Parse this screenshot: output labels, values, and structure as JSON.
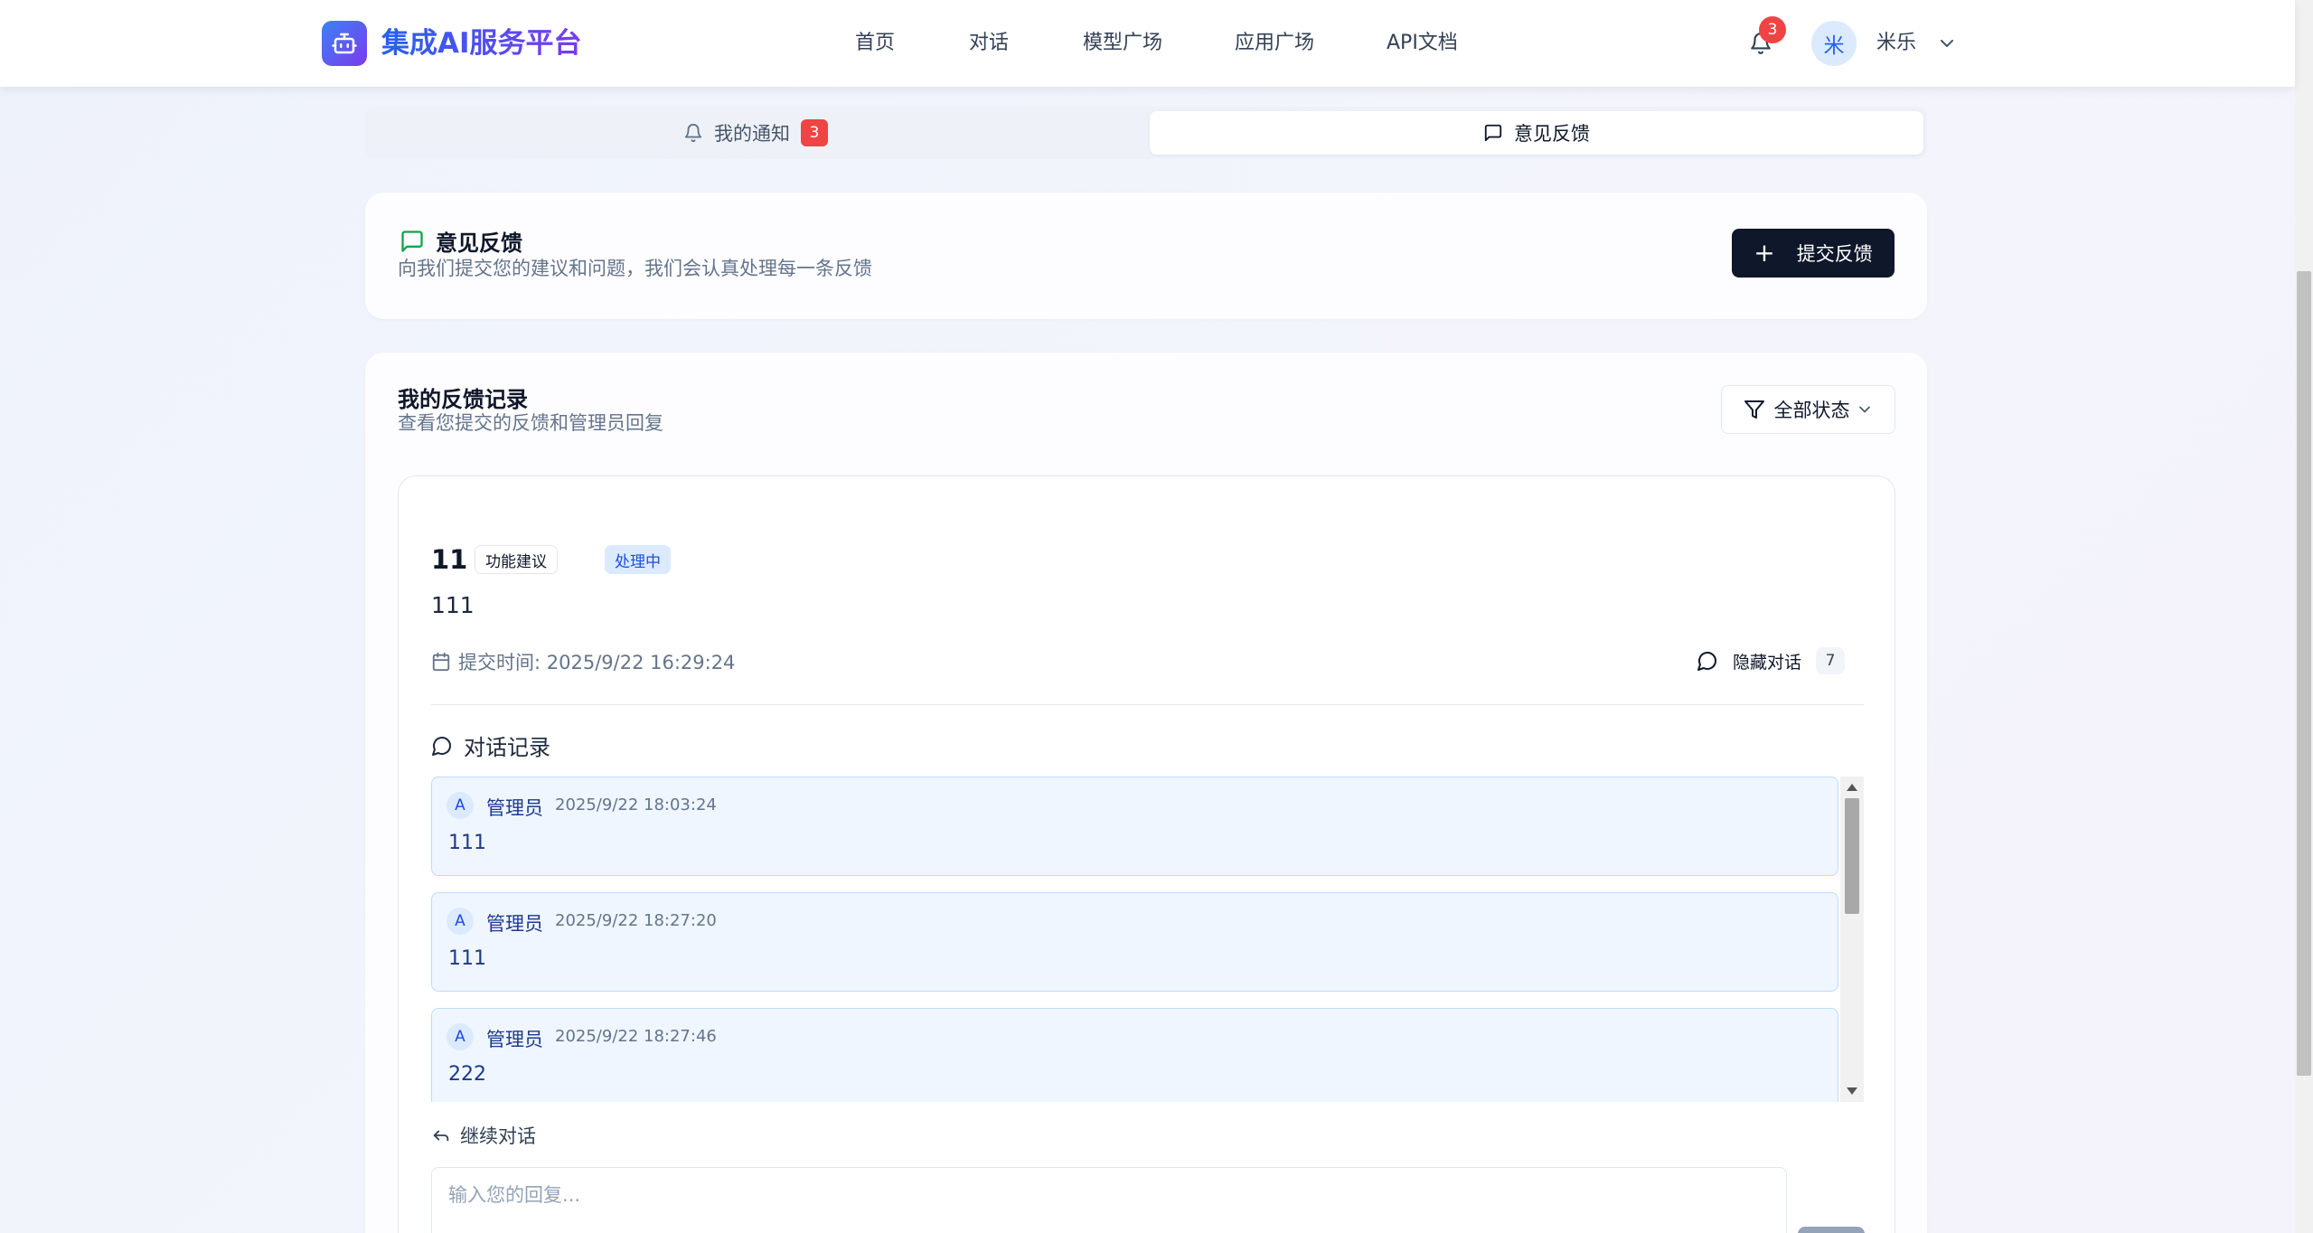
{
  "app": {
    "logo_text": "集成AI服务平台"
  },
  "nav": {
    "links": [
      "首页",
      "对话",
      "模型广场",
      "应用广场",
      "API文档"
    ],
    "notification_count": "3",
    "user_avatar": "米",
    "user_name": "米乐"
  },
  "tabs": {
    "notifications_label": "我的通知",
    "notifications_badge": "3",
    "feedback_label": "意见反馈",
    "active": "feedback"
  },
  "feedback_header": {
    "title": "意见反馈",
    "subtitle": "向我们提交您的建议和问题，我们会认真处理每一条反馈",
    "submit_label": "提交反馈"
  },
  "records": {
    "title": "我的反馈记录",
    "subtitle": "查看您提交的反馈和管理员回复",
    "filter_label": "全部状态"
  },
  "feedback_item": {
    "title": "11",
    "type_tag": "功能建议",
    "status_tag": "处理中",
    "content": "111",
    "submit_time": "提交时间: 2025/9/22 16:29:24",
    "hide_label": "隐藏对话",
    "message_count": "7",
    "conversation_title": "对话记录",
    "messages": [
      {
        "avatar": "A",
        "author": "管理员",
        "time": "2025/9/22 18:03:24",
        "text": "111"
      },
      {
        "avatar": "A",
        "author": "管理员",
        "time": "2025/9/22 18:27:20",
        "text": "111"
      },
      {
        "avatar": "A",
        "author": "管理员",
        "time": "2025/9/22 18:27:46",
        "text": "222"
      }
    ],
    "continue_label": "继续对话",
    "reply_placeholder": "输入您的回复..."
  },
  "colors": {
    "brand_start": "#3b82f6",
    "brand_end": "#7c3aed",
    "badge_red": "#ef4444",
    "primary_dark": "#0f172a",
    "feedback_green": "#16a34a",
    "message_bg": "#eff6ff"
  },
  "icons": {
    "logo": "robot-icon",
    "bell": "bell-icon",
    "chevron": "chevron-down-icon",
    "feedback": "message-square-icon",
    "filter": "filter-icon",
    "calendar": "calendar-icon",
    "chat": "message-circle-icon",
    "reply": "reply-icon",
    "plus": "plus-icon"
  }
}
